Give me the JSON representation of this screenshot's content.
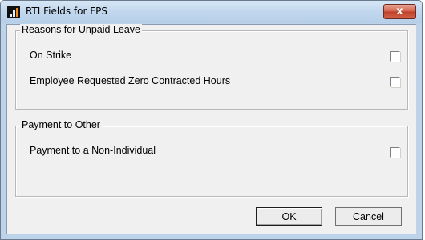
{
  "window": {
    "title": "RTI Fields for FPS",
    "close_label": "x"
  },
  "group_unpaid_leave": {
    "legend": "Reasons for Unpaid Leave",
    "items": [
      {
        "label": "On Strike",
        "checked": false
      },
      {
        "label": "Employee Requested Zero Contracted Hours",
        "checked": false
      }
    ]
  },
  "group_payment_other": {
    "legend": "Payment to Other",
    "items": [
      {
        "label": "Payment to a Non-Individual",
        "checked": false
      }
    ]
  },
  "buttons": {
    "ok_label": "OK",
    "cancel_label": "Cancel"
  }
}
